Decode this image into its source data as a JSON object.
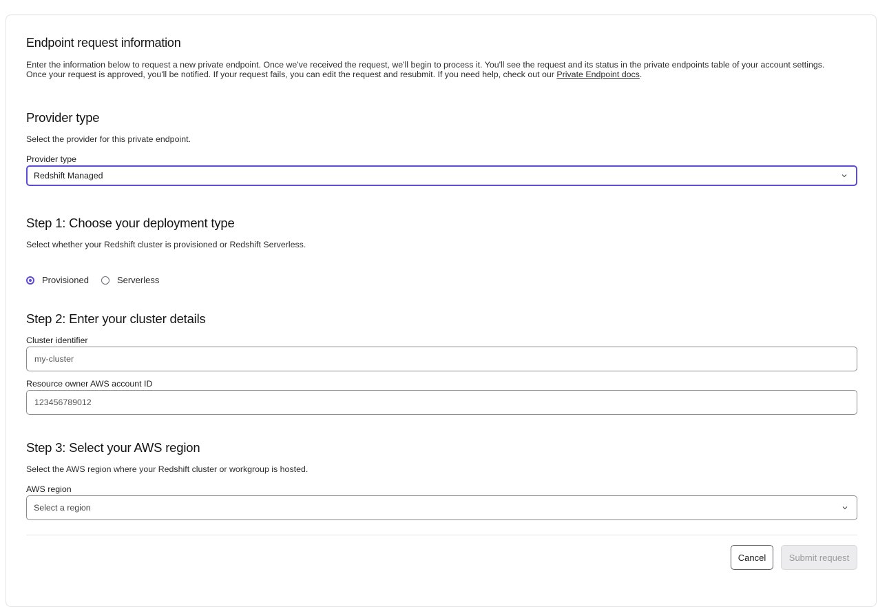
{
  "header": {
    "title": "Endpoint request information",
    "description_line1": "Enter the information below to request a new private endpoint. Once we've received the request, we'll begin to process it. You'll see the request and its status in the private endpoints table of your account settings.",
    "description_line2_prefix": "Once your request is approved, you'll be notified. If your request fails, you can edit the request and resubmit. If you need help, check out our ",
    "docs_link": "Private Endpoint docs",
    "description_line2_suffix": "."
  },
  "provider": {
    "title": "Provider type",
    "description": "Select the provider for this private endpoint.",
    "label": "Provider type",
    "value": "Redshift Managed",
    "icon": "chevron-down-icon"
  },
  "step1": {
    "title": "Step 1: Choose your deployment type",
    "description": "Select whether your Redshift cluster is provisioned or Redshift Serverless.",
    "options": [
      {
        "label": "Provisioned",
        "checked": true
      },
      {
        "label": "Serverless",
        "checked": false
      }
    ]
  },
  "step2": {
    "title": "Step 2: Enter your cluster details",
    "cluster_label": "Cluster identifier",
    "cluster_placeholder": "my-cluster",
    "account_label": "Resource owner AWS account ID",
    "account_placeholder": "123456789012"
  },
  "step3": {
    "title": "Step 3: Select your AWS region",
    "description": "Select the AWS region where your Redshift cluster or workgroup is hosted.",
    "label": "AWS region",
    "placeholder": "Select a region",
    "icon": "chevron-down-icon"
  },
  "actions": {
    "cancel_label": "Cancel",
    "submit_label": "Submit request"
  },
  "colors": {
    "accent": "#5b4bd6",
    "border": "#8a8a8e",
    "disabled_bg": "#ececee"
  }
}
